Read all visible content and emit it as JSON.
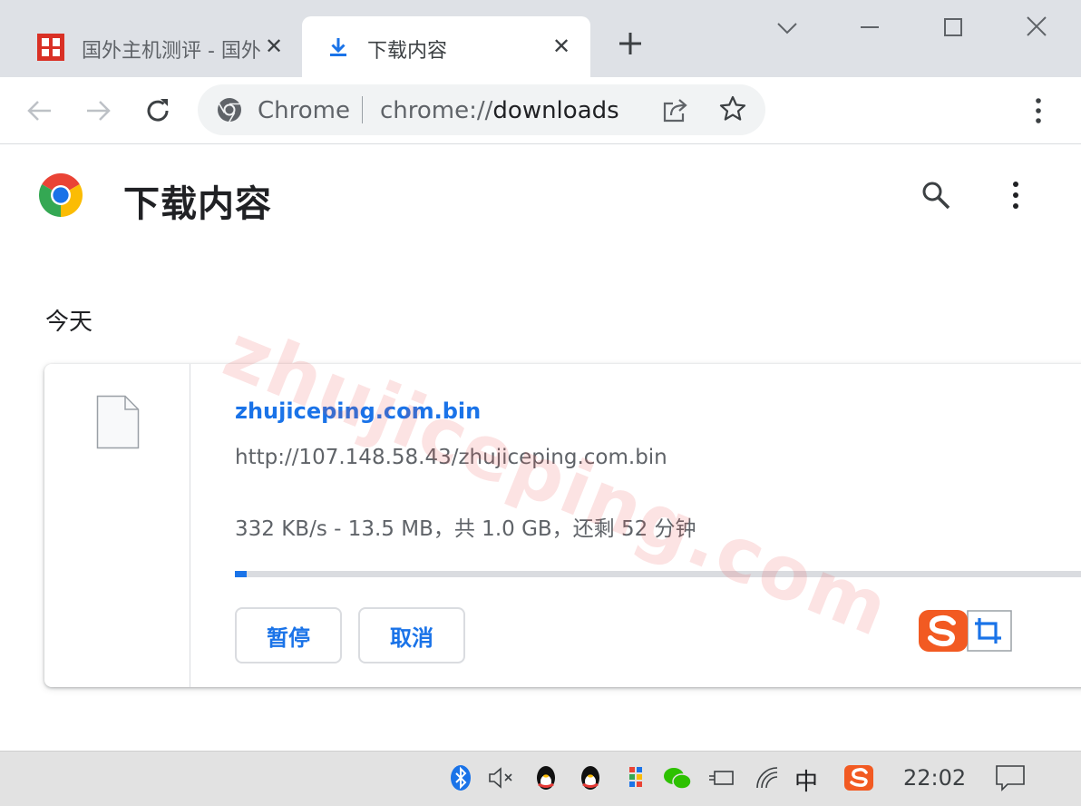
{
  "browser": {
    "tabs": [
      {
        "title": "国外主机测评 - 国外",
        "active": false
      },
      {
        "title": "下载内容",
        "active": true
      }
    ],
    "omnibox": {
      "site_label": "Chrome",
      "url_prefix": "chrome://",
      "url_path": "downloads"
    }
  },
  "page": {
    "title": "下载内容",
    "section_label": "今天"
  },
  "download": {
    "file_name": "zhujiceping.com.bin",
    "source_url": "http://107.148.58.43/zhujiceping.com.bin",
    "status": "332 KB/s - 13.5 MB，共 1.0 GB，还剩 52 分钟",
    "progress_fraction": 0.0135,
    "pause_label": "暂停",
    "cancel_label": "取消"
  },
  "watermark_text": "zhujiceping.com",
  "taskbar": {
    "ime_label": "中",
    "clock": "22:02"
  },
  "colors": {
    "accent": "#1a73e8",
    "tabstrip": "#dee1e6",
    "taskbar": "#e2e2e2"
  }
}
